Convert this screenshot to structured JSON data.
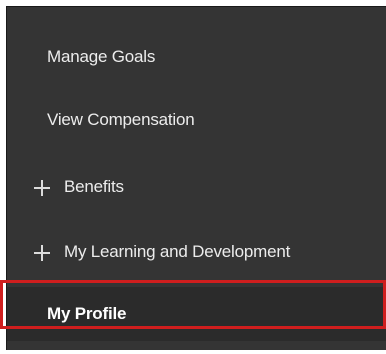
{
  "menu": {
    "items": [
      {
        "label": "Manage Goals",
        "expandable": false
      },
      {
        "label": "View Compensation",
        "expandable": false
      },
      {
        "label": "Benefits",
        "expandable": true,
        "icon": "plus-icon"
      },
      {
        "label": "My Learning and Development",
        "expandable": true,
        "icon": "plus-icon"
      },
      {
        "label": "My Profile",
        "expandable": false,
        "selected": true
      }
    ]
  },
  "colors": {
    "panel_background": "#343434",
    "text": "#ececec",
    "highlight_outline": "#cf1e1e"
  }
}
